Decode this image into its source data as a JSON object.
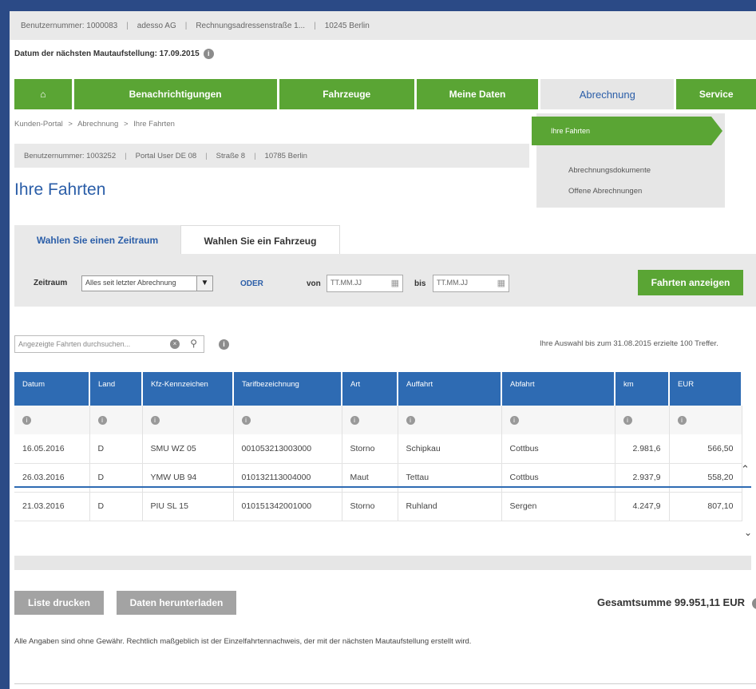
{
  "topbar": {
    "benutzernummer": "Benutzernummer: 1000083",
    "company": "adesso AG",
    "address": "Rechnungsadressenstraße 1...",
    "city": "10245 Berlin"
  },
  "mautline": {
    "text": "Datum der nächsten Mautaufstellung: 17.09.2015"
  },
  "nav": {
    "home_icon": "home-icon",
    "items": [
      "Benachrichtigungen",
      "Fahrzeuge",
      "Meine Daten",
      "Abrechnung",
      "Service"
    ]
  },
  "breadcrumb": [
    "Kunden-Portal",
    "Abrechnung",
    "Ihre Fahrten"
  ],
  "userbar": {
    "benutzernummer": "Benutzernummer: 1003252",
    "user": "Portal User DE 08",
    "street": "Straße 8",
    "city": "10785 Berlin"
  },
  "dropdown": {
    "selected": "Ihre Fahrten",
    "items": [
      "Abrechnungsdokumente",
      "Offene Abrechnungen"
    ]
  },
  "page_title": "Ihre Fahrten",
  "tabs": [
    "Wahlen Sie einen Zeitraum",
    "Wahlen Sie ein Fahrzeug"
  ],
  "filter": {
    "zeitraum_label": "Zeitraum",
    "zeitraum_value": "Alles seit letzter Abrechnung",
    "oder": "ODER",
    "von_label": "von",
    "von_placeholder": "TT.MM.JJ",
    "bis_label": "bis",
    "bis_placeholder": "TT.MM.JJ",
    "button": "Fahrten anzeigen"
  },
  "search": {
    "placeholder": "Angezeigte Fahrten durchsuchen..."
  },
  "result_info": "Ihre Auswahl bis zum 31.08.2015 erzielte 100 Treffer.",
  "table": {
    "headers": [
      "Datum",
      "Land",
      "Kfz-Kennzeichen",
      "Tarifbezeichnung",
      "Art",
      "Auffahrt",
      "Abfahrt",
      "km",
      "EUR"
    ],
    "rows": [
      [
        "16.05.2016",
        "D",
        "SMU WZ 05",
        "001053213003000",
        "Storno",
        "Schipkau",
        "Cottbus",
        "2.981,6",
        "566,50"
      ],
      [
        "26.03.2016",
        "D",
        "YMW UB 94",
        "010132113004000",
        "Maut",
        "Tettau",
        "Cottbus",
        "2.937,9",
        "558,20"
      ],
      [
        "21.03.2016",
        "D",
        "PIU SL 15",
        "010151342001000",
        "Storno",
        "Ruhland",
        "Sergen",
        "4.247,9",
        "807,10"
      ]
    ]
  },
  "buttons": {
    "print": "Liste drucken",
    "download": "Daten herunterladen"
  },
  "total": "Gesamtsumme 99.951,11 EUR",
  "disclaimer": "Alle Angaben sind ohne Gewähr. Rechtlich maßgeblich ist der Einzelfahrtennachweis, der mit der nächsten Mautaufstellung erstellt wird."
}
